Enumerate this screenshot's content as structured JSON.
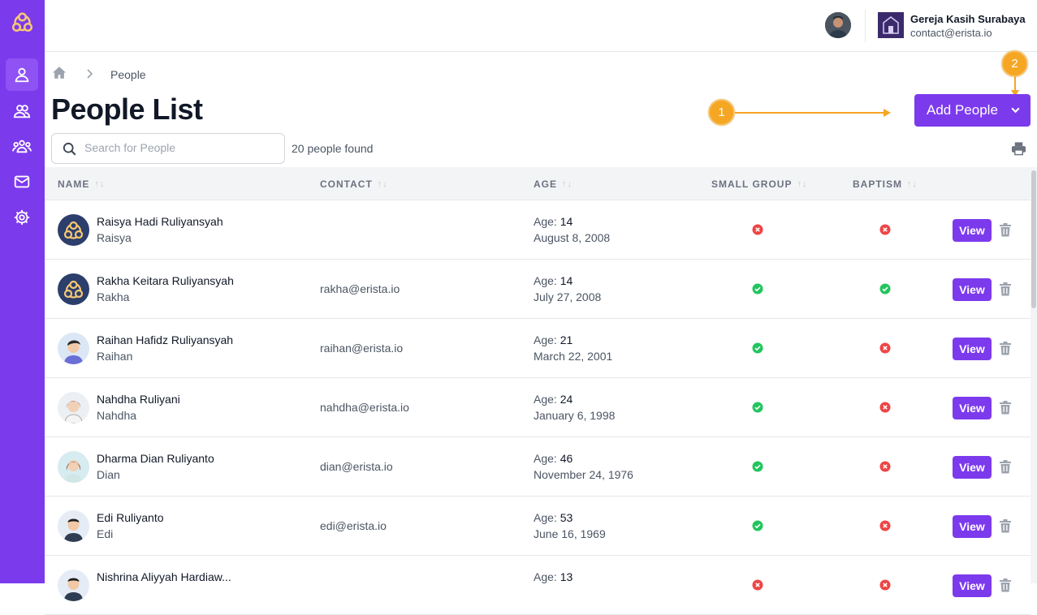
{
  "app": {
    "accent": "#7c3aed"
  },
  "sidebar": {
    "items": [
      {
        "icon": "user-icon",
        "active": true
      },
      {
        "icon": "users-icon",
        "active": false
      },
      {
        "icon": "groups-icon",
        "active": false
      },
      {
        "icon": "mail-icon",
        "active": false
      },
      {
        "icon": "gear-icon",
        "active": false
      }
    ]
  },
  "header": {
    "org_name": "Gereja Kasih Surabaya",
    "org_email": "contact@erista.io"
  },
  "breadcrumb": {
    "current": "People"
  },
  "page": {
    "title": "People List",
    "add_label": "Add People",
    "search_placeholder": "Search for People",
    "count_text": "20 people found"
  },
  "callouts": [
    "1",
    "2"
  ],
  "table": {
    "columns": [
      "NAME",
      "CONTACT",
      "AGE",
      "SMALL GROUP",
      "BAPTISM"
    ],
    "age_label": "Age:",
    "view_label": "View",
    "rows": [
      {
        "name": "Raisya Hadi Ruliyansyah",
        "nick": "Raisya",
        "email": "",
        "age": "14",
        "dob": "August 8, 2008",
        "small_group": false,
        "baptism": false,
        "avatar": "logo"
      },
      {
        "name": "Rakha Keitara Ruliyansyah",
        "nick": "Rakha",
        "email": "rakha@erista.io",
        "age": "14",
        "dob": "July 27, 2008",
        "small_group": true,
        "baptism": true,
        "avatar": "logo"
      },
      {
        "name": "Raihan Hafidz Ruliyansyah",
        "nick": "Raihan",
        "email": "raihan@erista.io",
        "age": "21",
        "dob": "March 22, 2001",
        "small_group": true,
        "baptism": false,
        "avatar": "boy"
      },
      {
        "name": "Nahdha Ruliyani",
        "nick": "Nahdha",
        "email": "nahdha@erista.io",
        "age": "24",
        "dob": "January 6, 1998",
        "small_group": true,
        "baptism": false,
        "avatar": "girl"
      },
      {
        "name": "Dharma Dian Ruliyanto",
        "nick": "Dian",
        "email": "dian@erista.io",
        "age": "46",
        "dob": "November 24, 1976",
        "small_group": true,
        "baptism": false,
        "avatar": "woman"
      },
      {
        "name": "Edi Ruliyanto",
        "nick": "Edi",
        "email": "edi@erista.io",
        "age": "53",
        "dob": "June 16, 1969",
        "small_group": true,
        "baptism": false,
        "avatar": "man"
      },
      {
        "name": "Nishrina Aliyyah Hardiaw...",
        "nick": "",
        "email": "",
        "age": "13",
        "dob": "",
        "small_group": false,
        "baptism": false,
        "avatar": "man"
      }
    ]
  }
}
